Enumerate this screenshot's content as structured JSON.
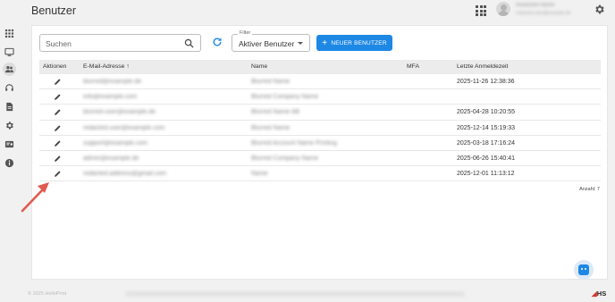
{
  "header": {
    "title": "Benutzer",
    "user_name": "Redacted Name",
    "user_email": "redacted.user@example.de"
  },
  "toolbar": {
    "search_placeholder": "Suchen",
    "filter_label": "Filter",
    "filter_value": "Aktiver Benutzer",
    "new_user_label": "NEUER BENUTZER"
  },
  "table": {
    "columns": [
      "Aktionen",
      "E-Mail-Adresse ↑",
      "Name",
      "MFA",
      "Letzte Anmeldezeit"
    ],
    "rows": [
      {
        "email": "blurred@example.de",
        "name": "Blurred Name",
        "mfa": "",
        "last_login": "2025-11-26 12:38:36"
      },
      {
        "email": "info@example.com",
        "name": "Blurred Company Name",
        "mfa": "",
        "last_login": ""
      },
      {
        "email": "blurred-user@example.de",
        "name": "Blurred Name AB",
        "mfa": "",
        "last_login": "2025-04-28 10:20:55"
      },
      {
        "email": "redacted.user@example.com",
        "name": "Blurred Name",
        "mfa": "",
        "last_login": "2025-12-14 15:19:33"
      },
      {
        "email": "support@example.com",
        "name": "Blurred Account Name Printing",
        "mfa": "",
        "last_login": "2025-03-18 17:16:24"
      },
      {
        "email": "admin@example.de",
        "name": "Blurred Company Name",
        "mfa": "",
        "last_login": "2025-06-26 15:40:41"
      },
      {
        "email": "redacted.address@gmail.com",
        "name": "Name",
        "mfa": "",
        "last_login": "2025-12-01 11:13:12"
      }
    ],
    "count_label": "Anzahl: 7"
  },
  "footer": {
    "copyright": "© 2025 HelloPrint",
    "logo_text": "HS"
  },
  "colors": {
    "accent": "#1e88e5",
    "annotation_arrow": "#e05a4f"
  }
}
